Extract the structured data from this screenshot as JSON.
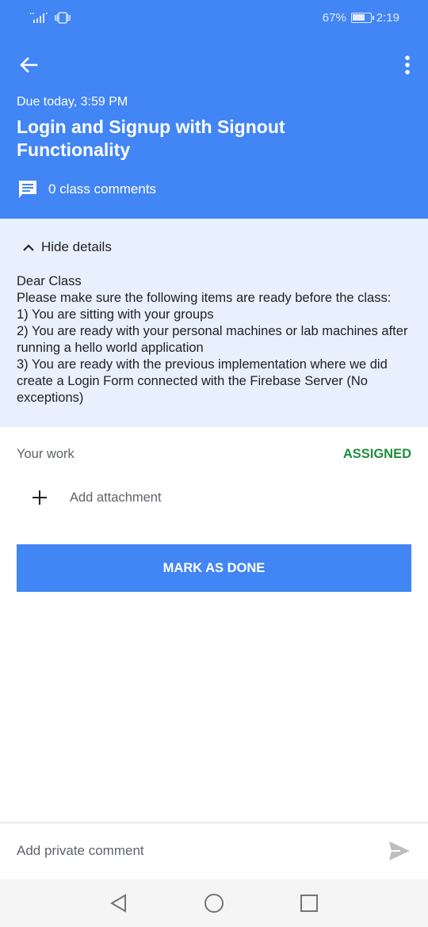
{
  "status_bar": {
    "battery_percent": "67%",
    "time": "2:19",
    "icons": [
      "signal-icon",
      "vibrate-icon",
      "battery-icon"
    ]
  },
  "header": {
    "due": "Due today, 3:59 PM",
    "title": "Login and Signup with Signout Functionality",
    "comments_label": "0 class comments",
    "background": "#4285f4",
    "icons": [
      "back-arrow-icon",
      "more-vert-icon",
      "comment-icon"
    ]
  },
  "details": {
    "toggle_label": "Hide details",
    "lines": [
      "Dear Class",
      "Please make sure the following items are ready before the class:",
      "1) You are sitting with your groups",
      "2) You are ready with your personal machines or lab machines after running a hello world application",
      "3) You are ready with the previous implementation where we did create a Login Form connected with the Firebase Server (No exceptions)"
    ],
    "background": "#e8f0fe"
  },
  "work": {
    "label": "Your work",
    "status": "ASSIGNED",
    "status_color": "#1e8e3e",
    "add_attachment": "Add attachment",
    "mark_done": "MARK AS DONE"
  },
  "private_comment": {
    "placeholder": "Add private comment"
  },
  "nav": {
    "icons": [
      "back-triangle-icon",
      "home-circle-icon",
      "recents-square-icon"
    ]
  }
}
